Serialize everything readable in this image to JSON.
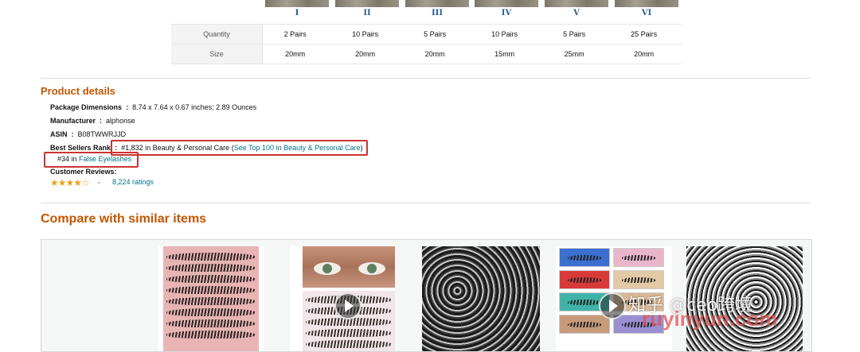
{
  "variants": {
    "roman": [
      "I",
      "II",
      "III",
      "IV",
      "V",
      "VI"
    ],
    "rows": [
      {
        "label": "Quantity",
        "cells": [
          "2 Pairs",
          "10 Pairs",
          "5 Pairs",
          "10 Pairs",
          "5 Pairs",
          "25 Pairs"
        ]
      },
      {
        "label": "Size",
        "cells": [
          "20mm",
          "20mm",
          "20mm",
          "15mm",
          "25mm",
          "20mm"
        ]
      }
    ]
  },
  "product_details": {
    "title": "Product details",
    "package_label": "Package Dimensions",
    "package_value": "8.74 x 7.64 x 0.67 inches; 2.89 Ounces",
    "manufacturer_label": "Manufacturer",
    "manufacturer_value": "alphonse",
    "asin_label": "ASIN",
    "asin_value": "B08TWWRJJD",
    "bsr_label": "Best Sellers Rank",
    "bsr_rank": "#1,832 in Beauty & Personal Care",
    "bsr_link": "See Top 100 in Beauty & Personal Care",
    "sub_rank": "#34 in",
    "sub_category": "False Eyelashes",
    "reviews_label": "Customer Reviews:",
    "stars": "★★★★☆",
    "rating_value": 4.5,
    "ratings_count": "8,224 ratings"
  },
  "compare": {
    "title": "Compare with similar items"
  },
  "watermark": {
    "line1": "知乎 @ceo跨境",
    "line2": "ruyinyun.com"
  },
  "colors": {
    "accent": "#c45500",
    "link": "#007185",
    "highlight": "#cc3333",
    "star": "#e8a317"
  }
}
